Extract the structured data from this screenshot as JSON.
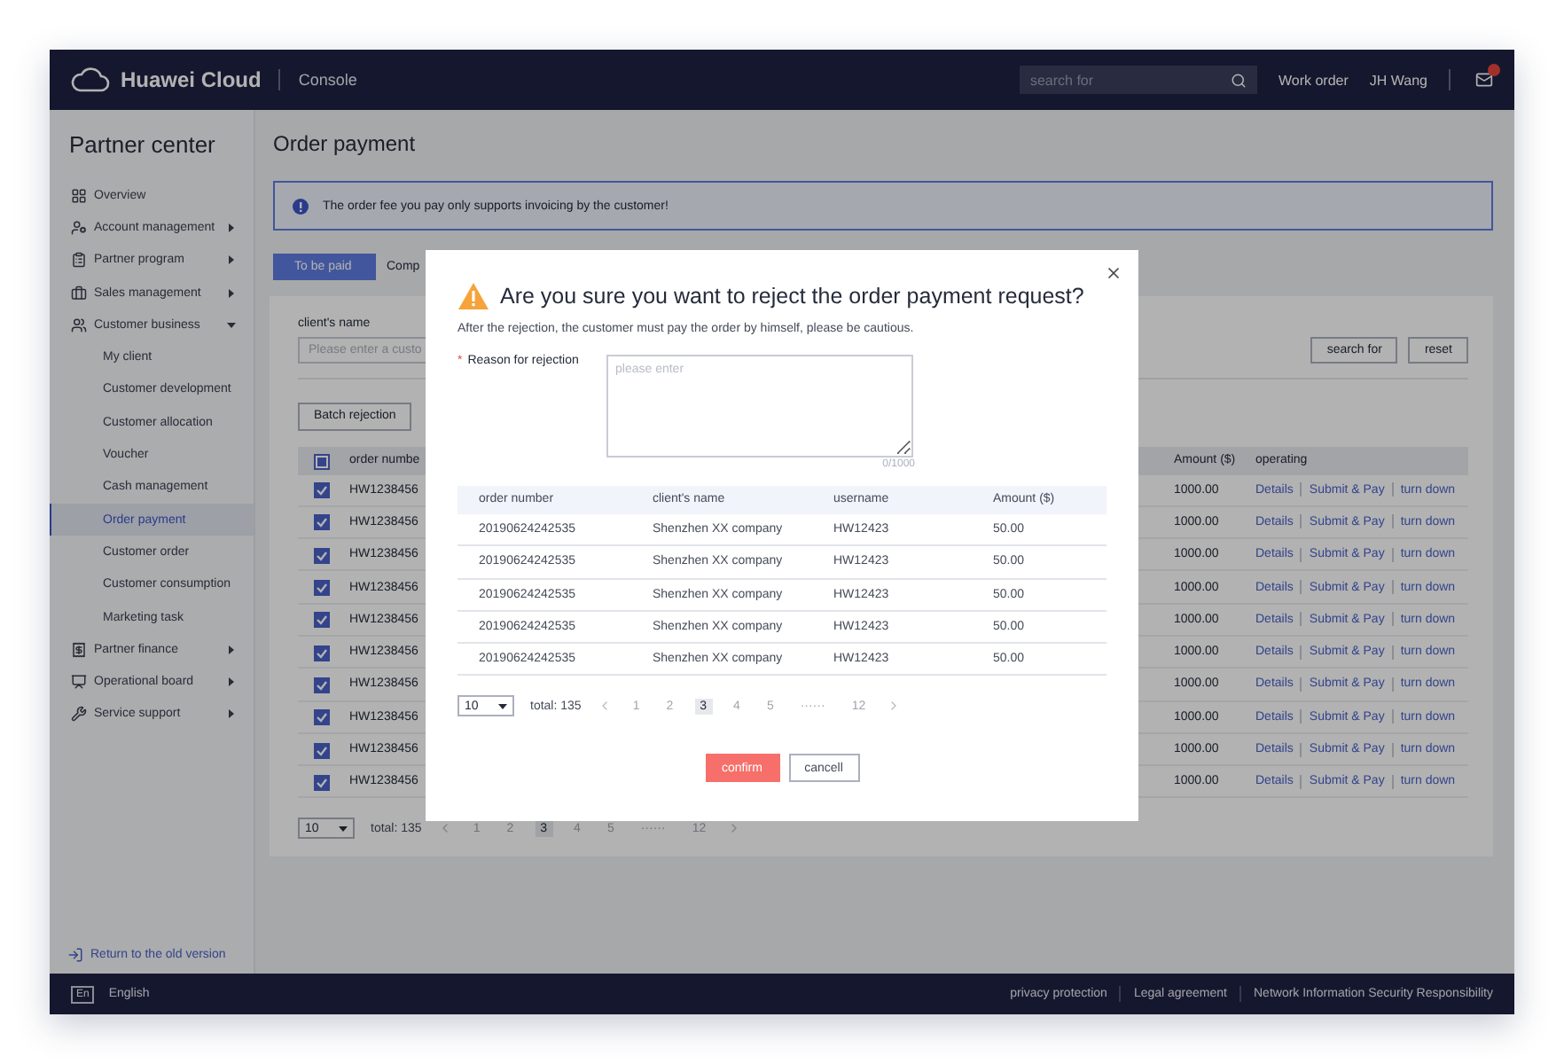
{
  "header": {
    "brand": "Huawei Cloud",
    "section": "Console",
    "search_placeholder": "search for",
    "links": [
      "Work order",
      "JH Wang"
    ],
    "mail_unread": true
  },
  "sidebar": {
    "title": "Partner center",
    "items": [
      {
        "label": "Overview",
        "kind": "link"
      },
      {
        "label": "Account management",
        "kind": "group",
        "expanded": false
      },
      {
        "label": "Partner program",
        "kind": "group",
        "expanded": false
      },
      {
        "label": "Sales management",
        "kind": "group",
        "expanded": false
      },
      {
        "label": "Customer business",
        "kind": "group",
        "expanded": true,
        "children": [
          {
            "label": "My client",
            "selected": false
          },
          {
            "label": "Customer development",
            "selected": false
          },
          {
            "label": "Customer allocation",
            "selected": false
          },
          {
            "label": "Voucher",
            "selected": false
          },
          {
            "label": "Cash management",
            "selected": false
          },
          {
            "label": "Order payment",
            "selected": true
          },
          {
            "label": "Customer order",
            "selected": false
          },
          {
            "label": "Customer consumption",
            "selected": false
          },
          {
            "label": "Marketing task",
            "selected": false
          }
        ]
      },
      {
        "label": "Partner finance",
        "kind": "group",
        "expanded": false
      },
      {
        "label": "Operational board",
        "kind": "group",
        "expanded": false
      },
      {
        "label": "Service support",
        "kind": "group",
        "expanded": false
      }
    ],
    "return_link": "Return to the old version"
  },
  "page": {
    "title": "Order payment",
    "alert": "The order fee you pay only supports invoicing by the customer!",
    "tabs": [
      {
        "label": "To be paid",
        "selected": true
      },
      {
        "label": "Comp",
        "selected": false
      }
    ],
    "filter": {
      "label": "client's name",
      "placeholder": "Please enter a custo"
    },
    "search_button": "search for",
    "reset_button": "reset",
    "batch_button": "Batch rejection",
    "table": {
      "header_indeterminate": true,
      "columns": [
        "order numbe",
        "Amount ($)",
        "operating"
      ],
      "rows": [
        {
          "order_number": "HW1238456",
          "checked": true,
          "amount": "1000.00",
          "actions": [
            "Details",
            "Submit & Pay",
            "turn down"
          ]
        },
        {
          "order_number": "HW1238456",
          "checked": true,
          "amount": "1000.00",
          "actions": [
            "Details",
            "Submit & Pay",
            "turn down"
          ]
        },
        {
          "order_number": "HW1238456",
          "checked": true,
          "amount": "1000.00",
          "actions": [
            "Details",
            "Submit & Pay",
            "turn down"
          ]
        },
        {
          "order_number": "HW1238456",
          "checked": true,
          "amount": "1000.00",
          "actions": [
            "Details",
            "Submit & Pay",
            "turn down"
          ]
        },
        {
          "order_number": "HW1238456",
          "checked": true,
          "amount": "1000.00",
          "actions": [
            "Details",
            "Submit & Pay",
            "turn down"
          ]
        },
        {
          "order_number": "HW1238456",
          "checked": true,
          "amount": "1000.00",
          "actions": [
            "Details",
            "Submit & Pay",
            "turn down"
          ]
        },
        {
          "order_number": "HW1238456",
          "checked": true,
          "amount": "1000.00",
          "actions": [
            "Details",
            "Submit & Pay",
            "turn down"
          ]
        },
        {
          "order_number": "HW1238456",
          "checked": true,
          "amount": "1000.00",
          "actions": [
            "Details",
            "Submit & Pay",
            "turn down"
          ]
        },
        {
          "order_number": "HW1238456",
          "checked": true,
          "amount": "1000.00",
          "actions": [
            "Details",
            "Submit & Pay",
            "turn down"
          ]
        },
        {
          "order_number": "HW1238456",
          "checked": true,
          "amount": "1000.00",
          "actions": [
            "Details",
            "Submit & Pay",
            "turn down"
          ]
        }
      ]
    },
    "pagination": {
      "page_size": "10",
      "total": "total: 135",
      "pages": [
        {
          "label": "1",
          "selected": false
        },
        {
          "label": "2",
          "selected": false
        },
        {
          "label": "3",
          "selected": true
        },
        {
          "label": "4",
          "selected": false
        },
        {
          "label": "5",
          "selected": false
        },
        {
          "label": "······",
          "selected": false
        },
        {
          "label": "12",
          "selected": false
        }
      ]
    }
  },
  "dialog": {
    "title": "Are you sure you want to reject the order payment request?",
    "subtitle": "After the rejection, the customer must pay the order by himself, please be cautious.",
    "reason_label": "Reason for rejection",
    "reason_required": true,
    "required_mark": "*",
    "reason_placeholder": "please enter",
    "counter": "0/1000",
    "columns": [
      "order number",
      "client's name",
      "username",
      "Amount ($)"
    ],
    "rows": [
      [
        "20190624242535",
        "Shenzhen XX company",
        "HW12423",
        "50.00"
      ],
      [
        "20190624242535",
        "Shenzhen XX company",
        "HW12423",
        "50.00"
      ],
      [
        "20190624242535",
        "Shenzhen XX company",
        "HW12423",
        "50.00"
      ],
      [
        "20190624242535",
        "Shenzhen XX company",
        "HW12423",
        "50.00"
      ],
      [
        "20190624242535",
        "Shenzhen XX company",
        "HW12423",
        "50.00"
      ]
    ],
    "pagination": {
      "page_size": "10",
      "total": "total: 135",
      "pages": [
        {
          "label": "1",
          "selected": false
        },
        {
          "label": "2",
          "selected": false
        },
        {
          "label": "3",
          "selected": true
        },
        {
          "label": "4",
          "selected": false
        },
        {
          "label": "5",
          "selected": false
        },
        {
          "label": "······",
          "selected": false
        },
        {
          "label": "12",
          "selected": false
        }
      ]
    },
    "confirm": "confirm",
    "cancel": "cancell"
  },
  "footer": {
    "language_badge": "En",
    "language": "English",
    "links": [
      "privacy protection",
      "Legal agreement",
      "Network Information Security Responsibility"
    ]
  }
}
